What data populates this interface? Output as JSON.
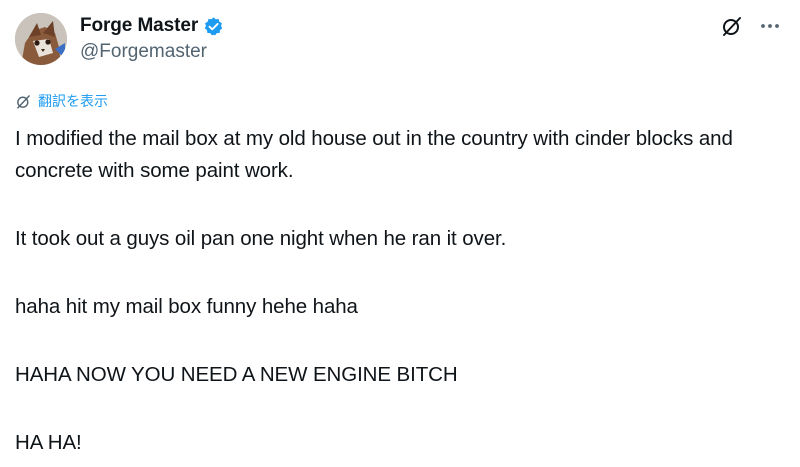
{
  "author": {
    "display_name": "Forge Master",
    "handle": "@Forgemaster",
    "verified": true,
    "avatar_icon": "avatar-image"
  },
  "actions": {
    "grok_icon": "grok-icon",
    "more_icon": "more-icon"
  },
  "translate": {
    "label": "翻訳を表示",
    "icon": "translate-icon"
  },
  "tweet": {
    "paragraphs": [
      "I modified the mail box at my old house out in the country with cinder blocks and concrete with some paint work.",
      "It took out a guys oil pan one night when he ran it over.",
      "haha hit my mail box funny hehe haha",
      "HAHA NOW YOU NEED A NEW ENGINE BITCH",
      "HA HA!"
    ]
  },
  "colors": {
    "text": "#0f1419",
    "secondary": "#536471",
    "accent": "#1d9bf0"
  }
}
